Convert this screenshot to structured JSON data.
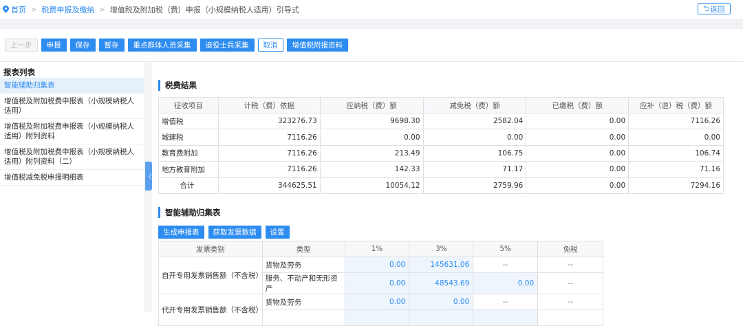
{
  "breadcrumb": {
    "home": "首页",
    "level1": "税费申报及缴纳",
    "current": "增值税及附加税（费）申报（小规模纳税人适用）引导式"
  },
  "back_label": "返回",
  "toolbar": {
    "prev": "上一步",
    "declare": "申报",
    "save": "保存",
    "temp_save": "暂存",
    "key_group": "重点群体人员采集",
    "veteran": "退役士兵采集",
    "cancel": "取消",
    "vat_attach": "增值税附报资料"
  },
  "sidebar": {
    "title": "报表列表",
    "items": [
      {
        "label": "智能辅助归集表"
      },
      {
        "label": "增值税及附加税费申报表（小规模纳税人适用）"
      },
      {
        "label": "增值税及附加税费申报表（小规模纳税人适用）附列资料"
      },
      {
        "label": "增值税及附加税费申报表（小规模纳税人适用）附列资料（二）"
      },
      {
        "label": "增值税减免税申报明细表"
      }
    ]
  },
  "tax_result": {
    "title": "税费结果",
    "headers": [
      "征收项目",
      "计税（费）依据",
      "应纳税（费）额",
      "减免税（费）额",
      "已缴税（费）额",
      "应补（退）税（费）额"
    ],
    "rows": [
      [
        "增值税",
        "323276.73",
        "9698.30",
        "2582.04",
        "0.00",
        "7116.26"
      ],
      [
        "城建税",
        "7116.26",
        "0.00",
        "0.00",
        "0.00",
        "0.00"
      ],
      [
        "教育费附加",
        "7116.26",
        "213.49",
        "106.75",
        "0.00",
        "106.74"
      ],
      [
        "地方教育附加",
        "7116.26",
        "142.33",
        "71.17",
        "0.00",
        "71.16"
      ],
      [
        "合计",
        "344625.51",
        "10054.12",
        "2759.96",
        "0.00",
        "7294.16"
      ]
    ]
  },
  "aggregation": {
    "title": "智能辅助归集表",
    "buttons": {
      "generate": "生成申报表",
      "fetch": "获取发票数据",
      "settings": "设置"
    },
    "headers": [
      "发票类别",
      "类型",
      "1%",
      "3%",
      "5%",
      "免税"
    ],
    "groups": [
      {
        "category": "自开专用发票销售额（不含税）",
        "rows": [
          {
            "type": "货物及劳务",
            "r1": "0.00",
            "r3": "145631.06",
            "r5": "--",
            "free": "--"
          },
          {
            "type": "服务、不动产和无形资产",
            "r1": "0.00",
            "r3": "48543.69",
            "r5": "0.00",
            "free": "--"
          }
        ]
      },
      {
        "category": "代开专用发票销售额（不含税）",
        "rows": [
          {
            "type": "货物及劳务",
            "r1": "0.00",
            "r3": "0.00",
            "r5": "--",
            "free": "--"
          }
        ]
      }
    ]
  }
}
